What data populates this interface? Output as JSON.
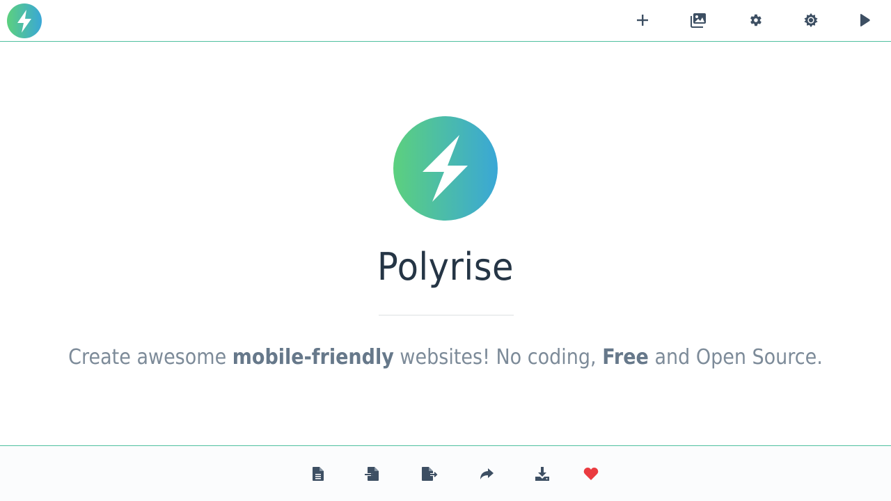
{
  "app": {
    "title": "Polyrise",
    "tagline": {
      "part1": "Create awesome ",
      "bold1": "mobile-friendly",
      "part2": " websites! No coding, ",
      "bold2": "Free",
      "part3": " and Open Source."
    }
  },
  "topbar": {
    "logo_icon": "lightning-bolt-icon",
    "actions": [
      {
        "name": "add",
        "icon": "plus-icon"
      },
      {
        "name": "media",
        "icon": "images-icon"
      },
      {
        "name": "settings",
        "icon": "gear-icon"
      },
      {
        "name": "theme",
        "icon": "sun-icon"
      },
      {
        "name": "preview",
        "icon": "play-icon"
      }
    ]
  },
  "bottombar": {
    "actions": [
      {
        "name": "new-page",
        "icon": "file-icon"
      },
      {
        "name": "import",
        "icon": "file-import-icon"
      },
      {
        "name": "export",
        "icon": "file-export-icon"
      },
      {
        "name": "share",
        "icon": "share-icon"
      },
      {
        "name": "download",
        "icon": "download-icon"
      },
      {
        "name": "favorite",
        "icon": "heart-icon"
      }
    ]
  },
  "colors": {
    "brand_gradient_start": "#5cd07e",
    "brand_gradient_end": "#3aa7d6",
    "border_accent": "#4fc09f",
    "icon": "#3d4f63",
    "heart": "#ea3b40",
    "text_muted": "#7d8b99"
  }
}
